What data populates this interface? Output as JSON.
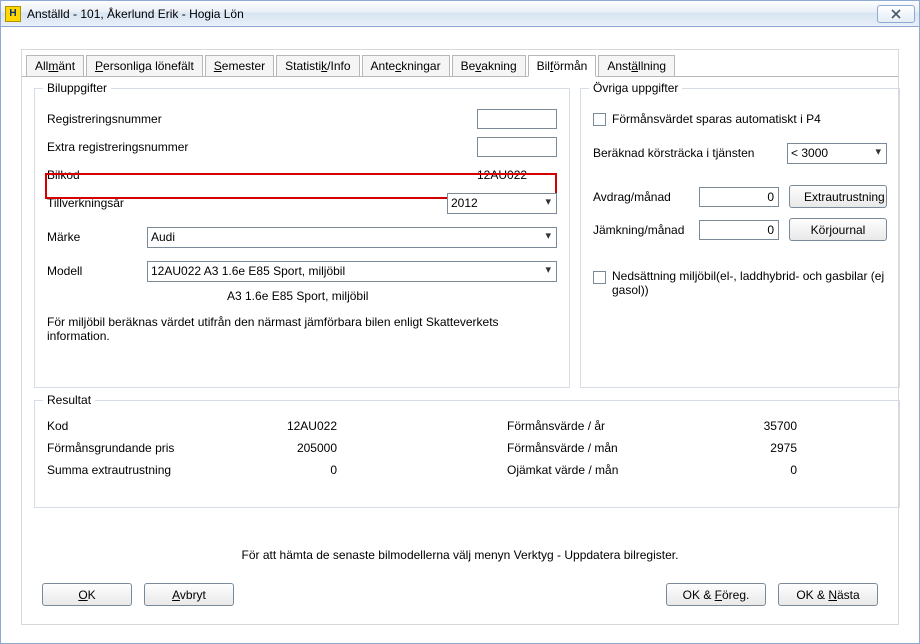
{
  "window": {
    "title": "Anställd - 101, Åkerlund Erik - Hogia Lön",
    "icon_letter": "H"
  },
  "tabs": [
    {
      "label_pre": "All",
      "mn": "m",
      "label_post": "änt"
    },
    {
      "label_pre": "",
      "mn": "P",
      "label_post": "ersonliga lönefält"
    },
    {
      "label_pre": "",
      "mn": "S",
      "label_post": "emester"
    },
    {
      "label_pre": "Statisti",
      "mn": "k",
      "label_post": "/Info"
    },
    {
      "label_pre": "Ante",
      "mn": "c",
      "label_post": "kningar"
    },
    {
      "label_pre": "Be",
      "mn": "v",
      "label_post": "akning"
    },
    {
      "label_pre": "Bil",
      "mn": "f",
      "label_post": "örmån"
    },
    {
      "label_pre": "Anst",
      "mn": "ä",
      "label_post": "llning"
    }
  ],
  "active_tab_index": 6,
  "biluppgifter": {
    "legend": "Biluppgifter",
    "regnr_label": "Registreringsnummer",
    "regnr_value": "",
    "extra_regnr_label": "Extra registreringsnummer",
    "extra_regnr_value": "",
    "bilkod_label": "Bilkod",
    "bilkod_value": "12AU022",
    "year_label": "Tillverkningsår",
    "year_value": "2012",
    "marke_label": "Märke",
    "marke_value": "Audi",
    "modell_label": "Modell",
    "modell_value": "12AU022 A3 1.6e E85 Sport, miljöbil",
    "modell_sub": "A3 1.6e E85 Sport, miljöbil",
    "info_text": "För miljöbil beräknas värdet utifrån den närmast jämförbara bilen enligt Skatteverkets information."
  },
  "ovriga": {
    "legend": "Övriga uppgifter",
    "chk_p4_label": "Förmånsvärdet sparas automatiskt i P4",
    "korstr_label": "Beräknad körsträcka i tjänsten",
    "korstr_value": "< 3000",
    "avdrag_label": "Avdrag/månad",
    "avdrag_value": "0",
    "jamkning_label": "Jämkning/månad",
    "jamkning_value": "0",
    "extrautrustning_btn": "Extrautrustning",
    "korjournal_btn": "Körjournal",
    "nedsattning_label": "Nedsättning miljöbil(el-, laddhybrid- och gasbilar (ej gasol))"
  },
  "resultat": {
    "legend": "Resultat",
    "kod_label": "Kod",
    "kod_value": "12AU022",
    "pris_label": "Förmånsgrundande pris",
    "pris_value": "205000",
    "summa_label": "Summa extrautrustning",
    "summa_value": "0",
    "fv_ar_label": "Förmånsvärde / år",
    "fv_ar_value": "35700",
    "fv_man_label": "Förmånsvärde / mån",
    "fv_man_value": "2975",
    "oj_label": "Ojämkat värde / mån",
    "oj_value": "0"
  },
  "footer_note": "För att hämta de senaste bilmodellerna välj menyn Verktyg - Uppdatera bilregister.",
  "buttons": {
    "ok_pre": "",
    "ok_mn": "O",
    "ok_post": "K",
    "cancel_pre": "",
    "cancel_mn": "A",
    "cancel_post": "vbryt",
    "okprev_pre": "OK & ",
    "okprev_mn": "F",
    "okprev_post": "öreg.",
    "oknext_pre": "OK & ",
    "oknext_mn": "N",
    "oknext_post": "ästa"
  }
}
